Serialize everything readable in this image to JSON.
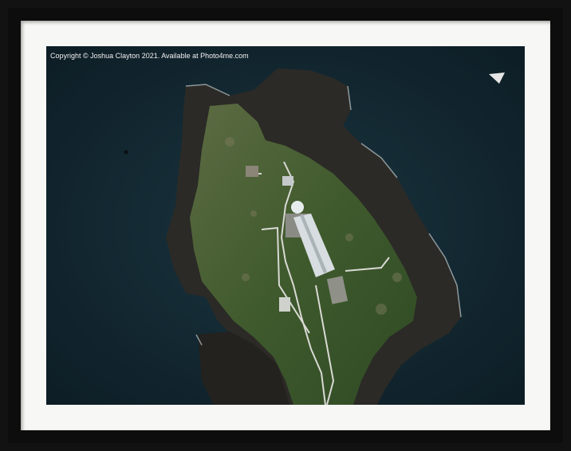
{
  "photo": {
    "copyright": "Copyright © Joshua Clayton 2021. Available at Photo4me.com",
    "subject": "aerial-island-lighthouse"
  },
  "colors": {
    "frame": "#121212",
    "mat": "#f7f7f5",
    "sea": "#12262f",
    "grass": "#3e5a2c",
    "rock": "#2b2a26"
  }
}
